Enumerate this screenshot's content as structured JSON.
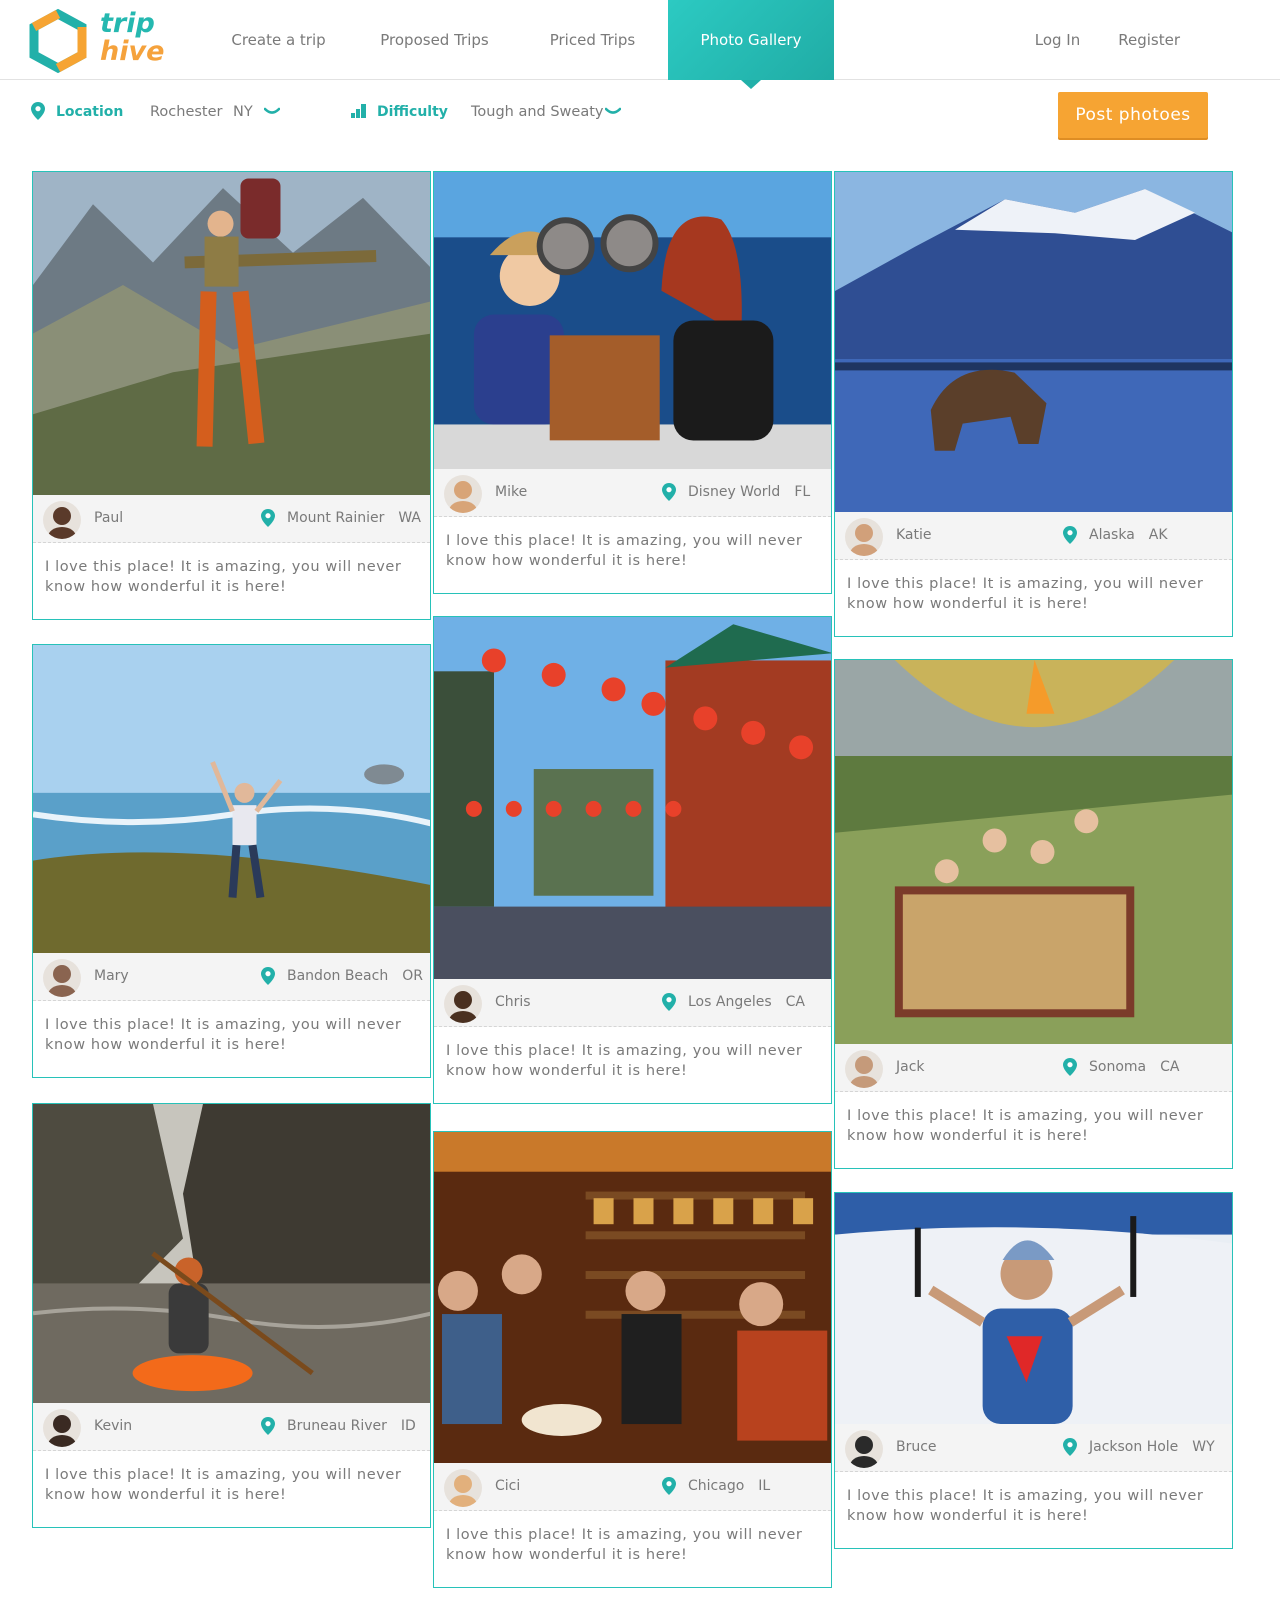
{
  "logo": {
    "line1": "trip",
    "line2": "hive"
  },
  "nav": {
    "items": [
      {
        "label": "Create a trip"
      },
      {
        "label": "Proposed Trips"
      },
      {
        "label": "Priced Trips"
      },
      {
        "label": "Photo Gallery"
      }
    ],
    "active_index": 3
  },
  "auth": {
    "login": "Log In",
    "register": "Register"
  },
  "filters": {
    "location_label": "Location",
    "location_city": "Rochester",
    "location_state": "NY",
    "difficulty_label": "Difficulty",
    "difficulty_value": "Tough and Sweaty"
  },
  "post_button": "Post photoes",
  "colors": {
    "accent": "#22b0a9",
    "orange": "#f6a433",
    "border": "#27c2b9"
  },
  "cards": [
    {
      "user": "Paul",
      "place": "Mount Rainier",
      "state": "WA",
      "caption": "I love this place! It is amazing, you will never know how wonderful it is here!",
      "photo": "hiker-on-mountain"
    },
    {
      "user": "Mike",
      "place": "Disney World",
      "state": "FL",
      "caption": "I love this place! It is amazing, you will never know how wonderful it is here!",
      "photo": "kids-with-robot"
    },
    {
      "user": "Katie",
      "place": "Alaska",
      "state": "AK",
      "caption": "I love this place! It is amazing, you will never know how wonderful it is here!",
      "photo": "bear-by-lake"
    },
    {
      "user": "Mary",
      "place": "Bandon Beach",
      "state": "OR",
      "caption": "I love this place! It is amazing, you will never know how wonderful it is here!",
      "photo": "woman-on-coast"
    },
    {
      "user": "Chris",
      "place": "Los Angeles",
      "state": "CA",
      "caption": "I love this place! It is amazing, you will never know how wonderful it is here!",
      "photo": "chinatown-street"
    },
    {
      "user": "Jack",
      "place": "Sonoma",
      "state": "CA",
      "caption": "I love this place! It is amazing, you will never know how wonderful it is here!",
      "photo": "hot-air-balloon"
    },
    {
      "user": "Kevin",
      "place": "Bruneau River",
      "state": "ID",
      "caption": "I love this place! It is amazing, you will never know how wonderful it is here!",
      "photo": "kayak-canyon"
    },
    {
      "user": "Cici",
      "place": "Chicago",
      "state": "IL",
      "caption": "I love this place! It is amazing, you will never know how wonderful it is here!",
      "photo": "food-shop"
    },
    {
      "user": "Bruce",
      "place": "Jackson Hole",
      "state": "WY",
      "caption": "I love this place! It is amazing, you will never know how wonderful it is here!",
      "photo": "climber-snow"
    }
  ]
}
